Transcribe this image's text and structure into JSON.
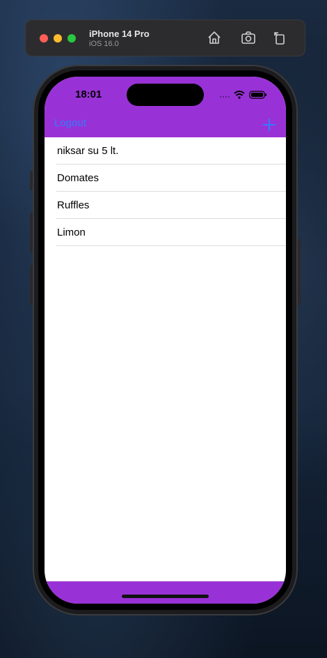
{
  "simulator": {
    "device_name": "iPhone 14 Pro",
    "os_version": "iOS 16.0",
    "toolbar_icons": [
      "home-icon",
      "screenshot-icon",
      "rotate-icon"
    ]
  },
  "status_bar": {
    "time": "18:01",
    "icons": [
      "signal-icon",
      "wifi-icon",
      "battery-icon"
    ]
  },
  "nav_bar": {
    "left_button": "Logout",
    "right_icon": "plus-icon"
  },
  "items": [
    {
      "label": "niksar su 5 lt."
    },
    {
      "label": "Domates"
    },
    {
      "label": "Ruffles"
    },
    {
      "label": "Limon"
    }
  ],
  "colors": {
    "nav_background": "#9932d6",
    "accent": "#2f7cff",
    "screen_background": "#ffffff"
  }
}
